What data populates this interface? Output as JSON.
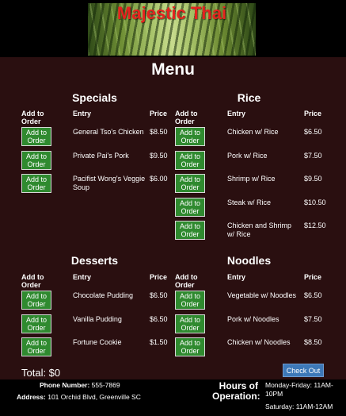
{
  "header": {
    "logo_text": "Majestic Thai"
  },
  "menu_title": "Menu",
  "columns": {
    "add": "Add to Order",
    "entry": "Entry",
    "price": "Price"
  },
  "button_label": "Add to Order",
  "sections": [
    {
      "title": "Specials",
      "items": [
        {
          "name": "General Tso's Chicken",
          "price": "$8.50"
        },
        {
          "name": "Private Pai's Pork",
          "price": "$9.50"
        },
        {
          "name": "Pacifist Wong's Veggie Soup",
          "price": "$6.00"
        }
      ]
    },
    {
      "title": "Rice",
      "items": [
        {
          "name": "Chicken w/ Rice",
          "price": "$6.50"
        },
        {
          "name": "Pork w/ Rice",
          "price": "$7.50"
        },
        {
          "name": "Shrimp w/ Rice",
          "price": "$9.50"
        },
        {
          "name": "Steak w/ Rice",
          "price": "$10.50"
        },
        {
          "name": "Chicken and Shrimp w/ Rice",
          "price": "$12.50"
        }
      ]
    },
    {
      "title": "Desserts",
      "items": [
        {
          "name": "Chocolate Pudding",
          "price": "$6.50"
        },
        {
          "name": "Vanilla Pudding",
          "price": "$6.50"
        },
        {
          "name": "Fortune Cookie",
          "price": "$1.50"
        }
      ]
    },
    {
      "title": "Noodles",
      "items": [
        {
          "name": "Vegetable w/ Noodles",
          "price": "$6.50"
        },
        {
          "name": "Pork w/ Noodles",
          "price": "$7.50"
        },
        {
          "name": "Chicken w/ Noodles",
          "price": "$8.50"
        }
      ]
    }
  ],
  "cart": {
    "total": "Total: $0",
    "checkout_label": "Check Out"
  },
  "footer": {
    "phone_label": "Phone Number:",
    "phone": "555-7869",
    "address_label": "Address:",
    "address": "101 Orchid Blvd, Greenville SC",
    "hours_label": "Hours of Operation:",
    "hours_weekday": "Monday-Friday: 11AM-10PM",
    "hours_saturday": "Saturday: 11AM-12AM"
  },
  "colors": {
    "background": "#2a0f10",
    "button_green": "#2f8a2f",
    "checkout_blue": "#3d78b8",
    "logo_red": "#e5231f"
  }
}
